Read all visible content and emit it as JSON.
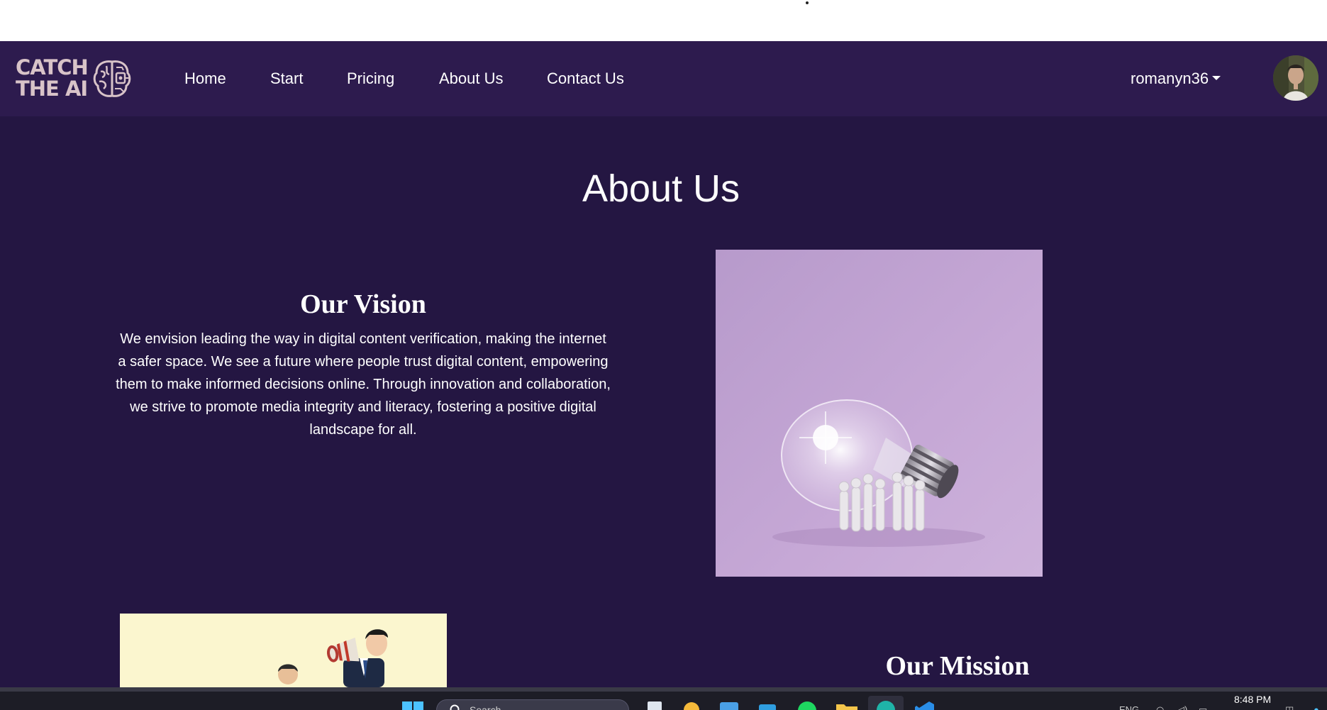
{
  "logo": {
    "line1": "CATCH",
    "line2": "THE AI",
    "icon": "brain-chip-icon"
  },
  "nav": {
    "links": [
      "Home",
      "Start",
      "Pricing",
      "About Us",
      "Contact Us"
    ],
    "username": "romanyn36",
    "avatar_icon": "user-avatar"
  },
  "page": {
    "title": "About Us"
  },
  "vision": {
    "title": "Our Vision",
    "text": "We envision leading the way in digital content verification, making the internet a safer space. We see a future where people trust digital content, empowering them to make informed decisions online. Through innovation and collaboration, we strive to promote media integrity and literacy, fostering a positive digital landscape for all."
  },
  "mission": {
    "title": "Our Mission"
  },
  "taskbar": {
    "search_placeholder": "Search",
    "clock": "8:48 PM",
    "tray_lang": "ENG"
  },
  "colors": {
    "navbar_bg": "#2d1b4e",
    "page_bg": "#241642",
    "image_bg": "#c4a3d2",
    "logo": "#d8c3c8"
  }
}
